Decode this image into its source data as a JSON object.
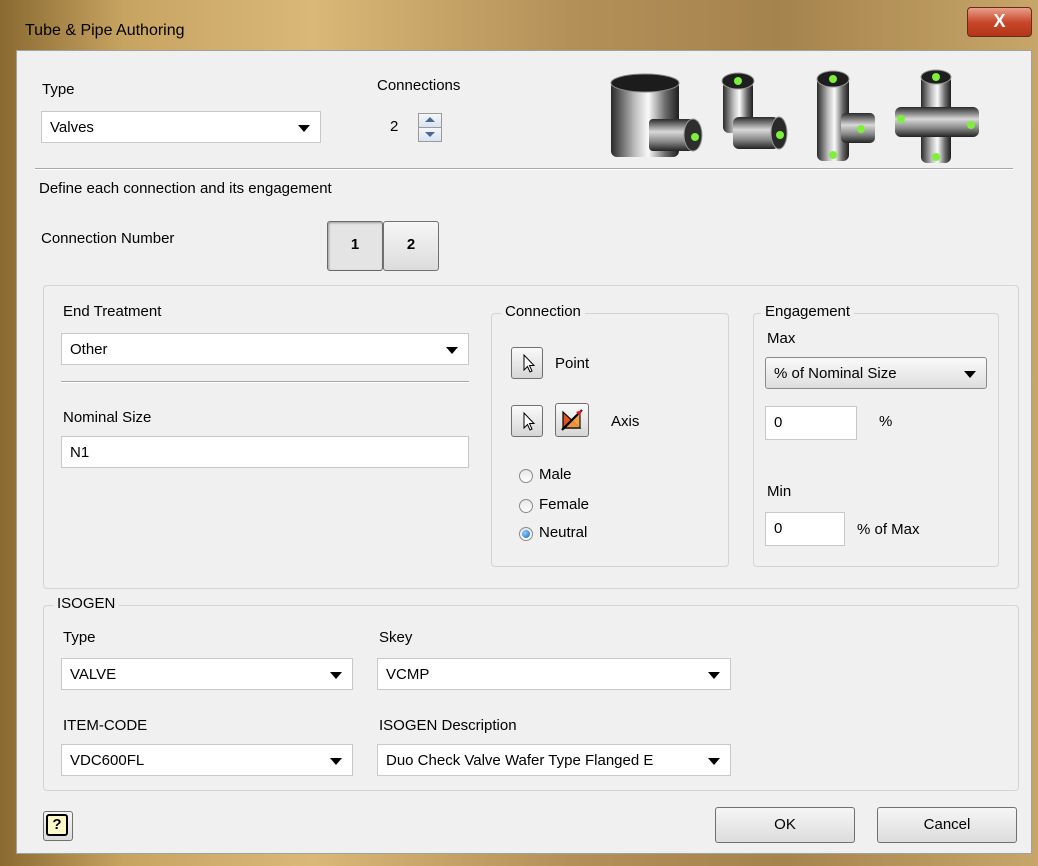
{
  "window": {
    "title": "Tube & Pipe Authoring",
    "close_glyph": "X"
  },
  "type_section": {
    "label": "Type",
    "value": "Valves"
  },
  "connections": {
    "label": "Connections",
    "value": "2"
  },
  "define_text": "Define each connection and its engagement",
  "connection_number": {
    "label": "Connection Number",
    "buttons": [
      "1",
      "2"
    ]
  },
  "end_treatment": {
    "label": "End Treatment",
    "value": "Other"
  },
  "nominal_size": {
    "label": "Nominal Size",
    "value": "N1"
  },
  "connection": {
    "legend": "Connection",
    "point_label": "Point",
    "axis_label": "Axis",
    "radios": [
      "Male",
      "Female",
      "Neutral"
    ],
    "selected": "Neutral"
  },
  "engagement": {
    "legend": "Engagement",
    "max_label": "Max",
    "max_mode": "% of Nominal Size",
    "max_value": "0",
    "max_unit": "%",
    "min_label": "Min",
    "min_value": "0",
    "min_unit": "% of Max"
  },
  "isogen": {
    "legend": "ISOGEN",
    "type_label": "Type",
    "type_value": "VALVE",
    "skey_label": "Skey",
    "skey_value": "VCMP",
    "item_code_label": "ITEM-CODE",
    "item_code_value": "VDC600FL",
    "description_label": "ISOGEN Description",
    "description_value": "Duo Check Valve Wafer Type Flanged E"
  },
  "footer": {
    "help_glyph": "?",
    "ok_label": "OK",
    "cancel_label": "Cancel"
  },
  "colors": {
    "connection_dot": "#7df03a",
    "close_button": "#c9482c"
  }
}
